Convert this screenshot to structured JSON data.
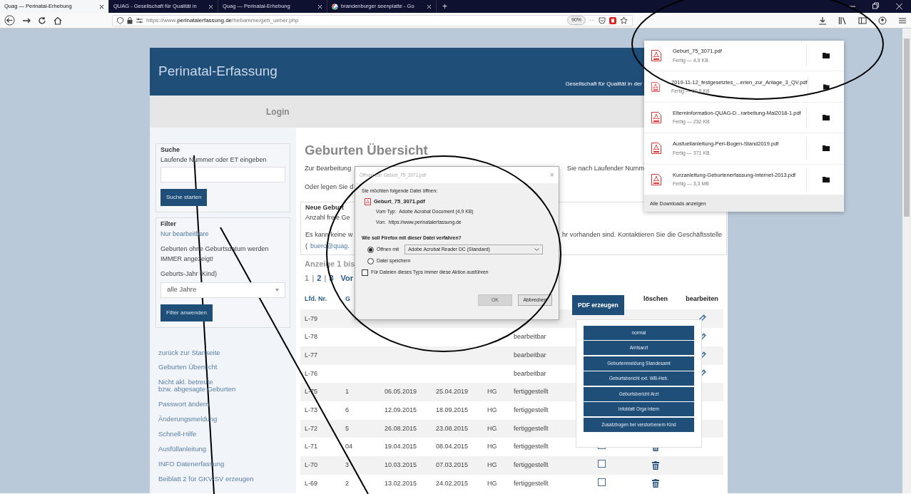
{
  "browser": {
    "tabs": [
      {
        "title": "Quag — Perinatal-Erhebung",
        "selected": true,
        "kind": "plain"
      },
      {
        "title": "QUAG - Gesellschaft für Qualität in",
        "selected": false,
        "kind": "plain"
      },
      {
        "title": "Quag — Perinatal-Erhebung",
        "selected": false,
        "kind": "plain"
      },
      {
        "title": "brandenburger seenplatte - Go",
        "selected": false,
        "kind": "search"
      }
    ],
    "new_tab": "+",
    "url": {
      "scheme": "https://www.",
      "domain": "perinatalerfassung.de",
      "path": "/hebamme/geb_ueber.php"
    },
    "zoom": "90%",
    "more": "···"
  },
  "header": {
    "title": "Perinatal-Erfassung",
    "subtitle": "Gesellschaft für Qualität in der"
  },
  "login": "Login",
  "sidebar": {
    "search": {
      "legend": "Suche",
      "label": "Laufende Nummer oder ET eingeben",
      "button": "Suche starten"
    },
    "filter": {
      "legend": "Filter",
      "link": "Nur bearbeitbare",
      "note": "Geburten ohne Geburtsdatum werden IMMER angezeigt!",
      "year_label": "Geburts-Jahr (Kind)",
      "year_value": "alle Jahre",
      "button": "Filter anwenden"
    },
    "links": [
      [
        "zurück zur Startseite"
      ],
      [
        "Geburten Übersicht"
      ],
      [
        "Nicht akl. betreute",
        "bzw. abgesagte Geburten"
      ],
      [
        "Passwort ändern"
      ],
      [
        "Änderungsmeldung"
      ],
      [
        "Schnell-Hilfe"
      ],
      [
        "Ausfüllanleitung"
      ],
      [
        "INFO Datenerfassung"
      ],
      [
        "Beiblatt 2 für GKV-SV erzeugen"
      ]
    ]
  },
  "main": {
    "title": "Geburten Übersicht",
    "intro": [
      "Zur Bearbeitung",
      "Sie nach Laufender Numm"
    ],
    "intro2": "Oder legen Sie d",
    "new_birth": {
      "legend": "Neue Geburt",
      "line1": "Anzahl freie Ge",
      "line2": [
        "Es kann keine w",
        "hr vorhanden sind. Kontaktieren Sie die Geschäftsstelle"
      ],
      "line3_prefix": "(",
      "email": "buero@quag."
    },
    "count": "Anzeige 1 bis",
    "page_separator": "|",
    "pages": [
      {
        "label": "1",
        "selected": true
      },
      {
        "label": "2",
        "selected": false
      },
      {
        "label": "3",
        "selected": false
      },
      {
        "label": "Vor",
        "selected": false
      }
    ],
    "table": {
      "columns": [
        {
          "label": "Lfd. Nr.",
          "kind": "sort"
        },
        {
          "label": "G",
          "kind": "sort"
        },
        {
          "label": "PDF erzeugen",
          "kind": "button"
        },
        {
          "label": "löschen",
          "kind": "plain"
        },
        {
          "label": "bearbeiten",
          "kind": "plain"
        }
      ],
      "rows": [
        {
          "cells": [
            "L-79",
            null,
            null,
            null,
            null,
            null
          ],
          "edit": true
        },
        {
          "cells": [
            "L-78",
            null,
            null,
            null,
            null,
            "bearbeitbar"
          ],
          "edit": true
        },
        {
          "cells": [
            "L-77",
            null,
            null,
            null,
            null,
            "bearbeitbar"
          ],
          "edit": true
        },
        {
          "cells": [
            "L-76",
            null,
            null,
            null,
            null,
            "bearbeitbar"
          ],
          "edit": true
        },
        {
          "cells": [
            "L-75",
            "1",
            "06.05.2019",
            "25.04.2019",
            "HG",
            "fertiggestellt"
          ]
        },
        {
          "cells": [
            "L-73",
            "6",
            "12.09.2015",
            "18.09.2015",
            "HG",
            "fertiggestellt"
          ]
        },
        {
          "cells": [
            "L-72",
            "5",
            "26.08.2015",
            "23.08.2015",
            "HG",
            "fertiggestellt"
          ]
        },
        {
          "cells": [
            "L-71",
            "04",
            "19.04.2015",
            "08.04.2015",
            "HG",
            "fertiggestellt"
          ],
          "select": {
            "checked": false
          },
          "delete": true
        },
        {
          "cells": [
            "L-70",
            "3",
            "10.03.2015",
            "07.03.2015",
            "HG",
            "fertiggestellt"
          ],
          "select": {
            "checked": false
          },
          "delete": true
        },
        {
          "cells": [
            "L-69",
            "2",
            "13.02.2015",
            "24.02.2015",
            "HG",
            "fertiggestellt"
          ],
          "select": {
            "checked": false
          },
          "delete": true
        }
      ]
    },
    "pdf_menu": [
      "normal",
      "Amtsarzt",
      "Geburtenmeldung Standesamt",
      "Geburtsbericht ext. WB-Heb.",
      "Geburtsbericht Arzt",
      "Infoblatt Orga intern",
      "Zusatzbogen bei verstorbenem Kind"
    ]
  },
  "downloads": {
    "items": [
      {
        "name": "Geburt_75_3071.pdf",
        "status": "Fertig — 4,9 KB"
      },
      {
        "name": "2019-11-12_festgesetztes_...erien_zur_Anlage_3_QV.pdf",
        "status": "Fertig — 60,8 KB"
      },
      {
        "name": "Elterninformation-QUAG-D...rarbeitung-Mai2018-1.pdf",
        "status": "Fertig — 232 KB"
      },
      {
        "name": "Ausfuellanleitung-Peri-Bogen-Stand2019.pdf",
        "status": "Fertig — 371 KB"
      },
      {
        "name": "Kurzanleitung-Geburtenerfassung-Internet-2013.pdf",
        "status": "Fertig — 3,3 MB"
      }
    ],
    "footer": "Alle Downloads anzeigen"
  },
  "dialog": {
    "title": "Öffnen von Geburt_75_3071.pdf",
    "close": "×",
    "prompt": "Sie möchten folgende Datei öffnen:",
    "file": "Geburt_75_3071.pdf",
    "type_label": "Vom Typ:",
    "type": "Adobe Acrobat Document (4,9 KB)",
    "from_label": "Von:",
    "from": "https://www.perinatalerfassung.de",
    "question": "Wie soll Firefox mit dieser Datei verfahren?",
    "options": [
      {
        "label": "Öffnen mit",
        "selected": true
      },
      {
        "label": "Datei speichern",
        "selected": false
      }
    ],
    "app": "Adobe Acrobat Reader DC (Standard)",
    "remember": {
      "label": "Für Dateien dieses Typs immer diese Aktion ausführen",
      "checked": false
    },
    "buttons": [
      {
        "label": "OK",
        "disabled": true
      },
      {
        "label": "Abbrechen",
        "disabled": false
      }
    ]
  }
}
